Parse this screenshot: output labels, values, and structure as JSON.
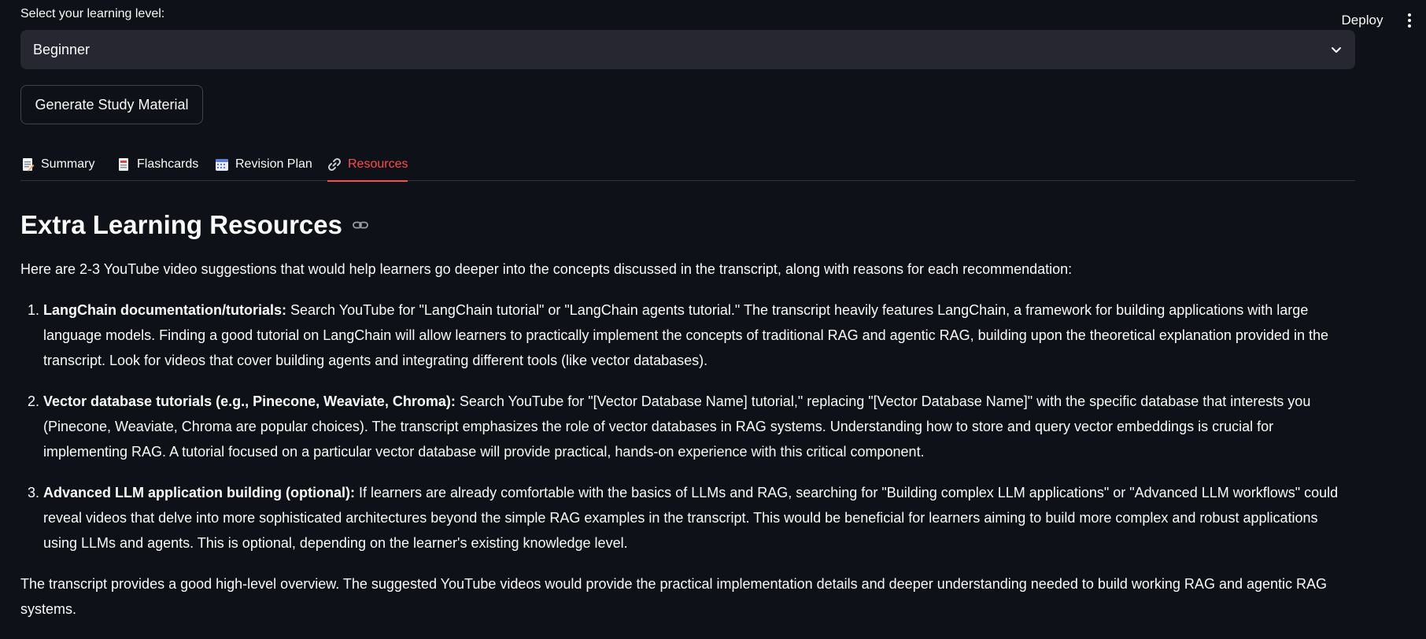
{
  "header": {
    "deploy_label": "Deploy",
    "menu_icon": "kebab-menu-icon"
  },
  "level_select": {
    "label": "Select your learning level:",
    "value": "Beginner"
  },
  "generate_button": {
    "label": "Generate Study Material"
  },
  "tabs": [
    {
      "label": "Summary",
      "icon": "memo-icon",
      "active": false
    },
    {
      "label": "Flashcards",
      "icon": "card-index-icon",
      "active": false
    },
    {
      "label": "Revision Plan",
      "icon": "calendar-icon",
      "active": false
    },
    {
      "label": "Resources",
      "icon": "link-icon",
      "active": true
    }
  ],
  "content": {
    "heading": "Extra Learning Resources",
    "intro": "Here are 2-3 YouTube video suggestions that would help learners go deeper into the concepts discussed in the transcript, along with reasons for each recommendation:",
    "recommendations": [
      {
        "title": "LangChain documentation/tutorials:",
        "text": "Search YouTube for \"LangChain tutorial\" or \"LangChain agents tutorial.\" The transcript heavily features LangChain, a framework for building applications with large language models. Finding a good tutorial on LangChain will allow learners to practically implement the concepts of traditional RAG and agentic RAG, building upon the theoretical explanation provided in the transcript. Look for videos that cover building agents and integrating different tools (like vector databases)."
      },
      {
        "title": "Vector database tutorials (e.g., Pinecone, Weaviate, Chroma):",
        "text": "Search YouTube for \"[Vector Database Name] tutorial,\" replacing \"[Vector Database Name]\" with the specific database that interests you (Pinecone, Weaviate, Chroma are popular choices). The transcript emphasizes the role of vector databases in RAG systems. Understanding how to store and query vector embeddings is crucial for implementing RAG. A tutorial focused on a particular vector database will provide practical, hands-on experience with this critical component."
      },
      {
        "title": "Advanced LLM application building (optional):",
        "text": "If learners are already comfortable with the basics of LLMs and RAG, searching for \"Building complex LLM applications\" or \"Advanced LLM workflows\" could reveal videos that delve into more sophisticated architectures beyond the simple RAG examples in the transcript. This would be beneficial for learners aiming to build more complex and robust applications using LLMs and agents. This is optional, depending on the learner's existing knowledge level."
      }
    ],
    "closing": "The transcript provides a good high-level overview. The suggested YouTube videos would provide the practical implementation details and deeper understanding needed to build working RAG and agentic RAG systems."
  },
  "colors": {
    "background": "#0e1117",
    "select_bg": "#262730",
    "accent": "#ff4b4b",
    "text": "#fafafa"
  }
}
